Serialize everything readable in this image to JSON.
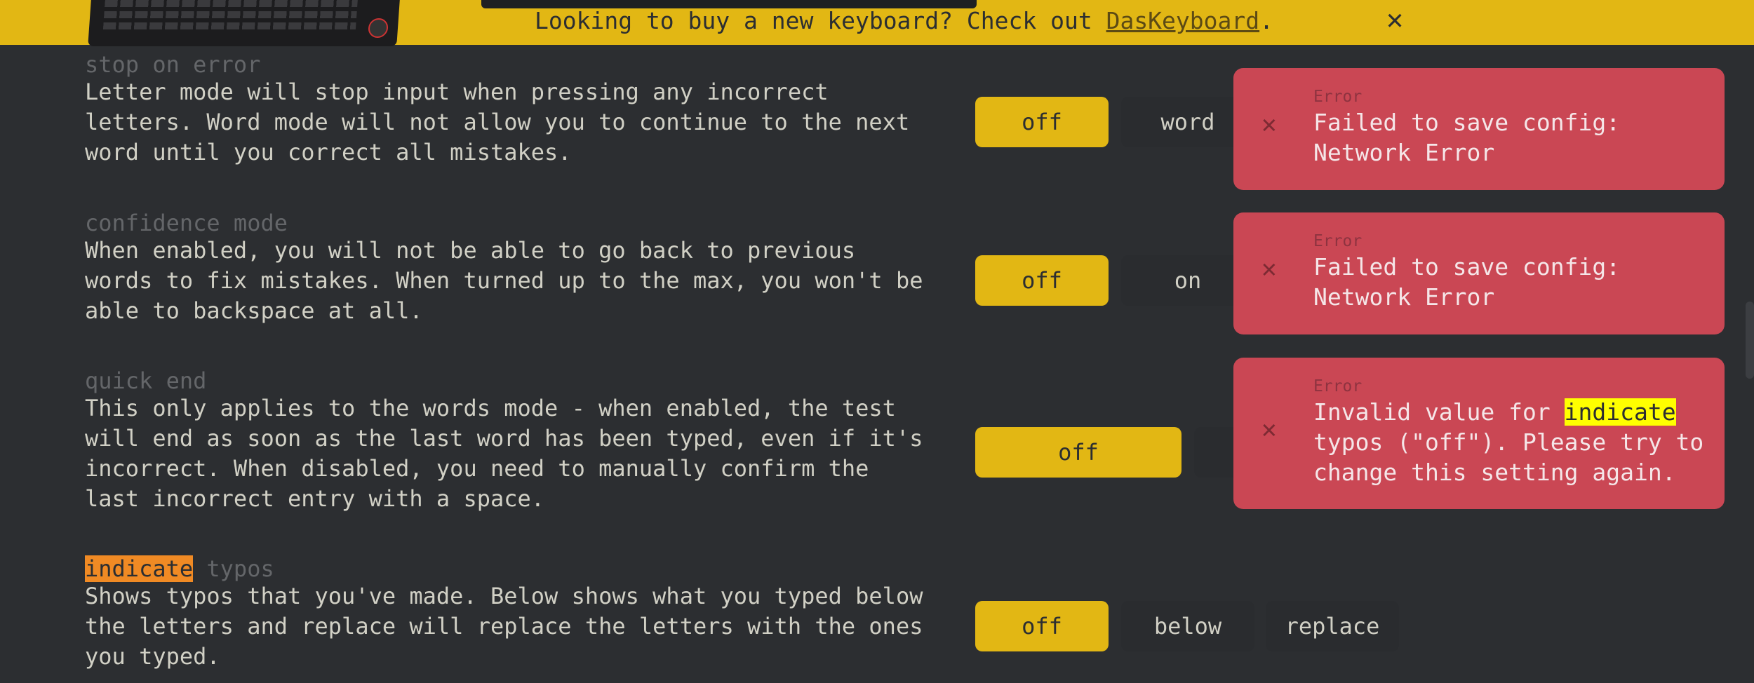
{
  "banner": {
    "text_before": "Looking to buy a new keyboard? Check out ",
    "link": "DasKeyboard",
    "text_after": ".",
    "close_icon": "close-icon"
  },
  "sections": {
    "stop_on_error": {
      "title": "stop on error",
      "desc": "Letter mode will stop input when pressing any incorrect letters. Word mode will not allow you to continue to the next word until you correct all mistakes.",
      "buttons": [
        "off",
        "word"
      ]
    },
    "confidence_mode": {
      "title": "confidence mode",
      "desc": "When enabled, you will not be able to go back to previous words to fix mistakes. When turned up to the max, you won't be able to backspace at all.",
      "buttons": [
        "off",
        "on"
      ]
    },
    "quick_end": {
      "title": "quick end",
      "desc": "This only applies to the words mode - when enabled, the test will end as soon as the last word has been typed, even if it's incorrect. When disabled, you need to manually confirm the last incorrect entry with a space.",
      "buttons": [
        "off"
      ]
    },
    "indicate_typos": {
      "title_highlight": "indicate",
      "title_rest": " typos",
      "desc": "Shows typos that you've made. Below shows what you typed below the letters and replace will replace the letters with the ones you typed.",
      "buttons": [
        "off",
        "below",
        "replace"
      ]
    }
  },
  "toasts": [
    {
      "label": "Error",
      "message": "Failed to save config: Network Error"
    },
    {
      "label": "Error",
      "message": "Failed to save config: Network Error"
    },
    {
      "label": "Error",
      "message_before": "Invalid value for ",
      "message_highlight": "indicate",
      "message_after": " typos (\"off\"). Please try to change this setting again."
    }
  ],
  "colors": {
    "background": "#2c2e31",
    "accent": "#e2b714",
    "error": "#ca4754",
    "text": "#d1d0c5",
    "subtext": "#646669"
  }
}
